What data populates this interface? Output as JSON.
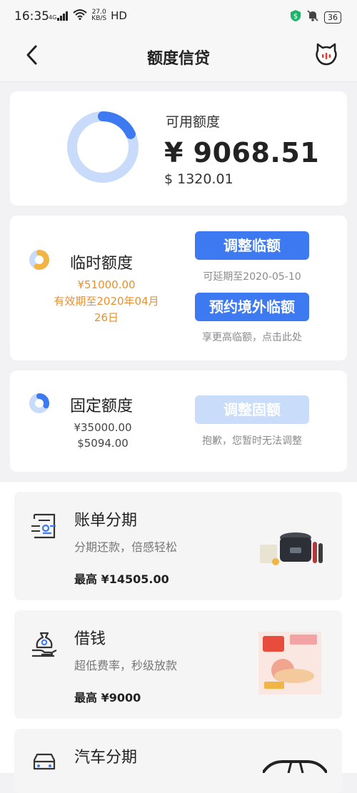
{
  "status": {
    "time": "16:35",
    "signal": "4G",
    "net_speed_value": "27.0",
    "net_speed_unit": "KB/S",
    "hd": "HD",
    "battery": "36"
  },
  "nav": {
    "title": "额度信贷",
    "back_icon": "chevron-left-icon",
    "service_icon": "customer-service-icon"
  },
  "balance": {
    "label": "可用额度",
    "cny": "¥ 9068.51",
    "usd": "$ 1320.01",
    "ring_fraction": 0.18,
    "colors": {
      "accent": "#3d7af2",
      "track": "#c8dbfa"
    }
  },
  "temp_limit": {
    "title": "临时额度",
    "amount": "¥51000.00",
    "validity_line1": "有效期至2020年04月",
    "validity_line2": "26日",
    "adjust_button": "调整临额",
    "extend_hint": "可延期至2020-05-10",
    "overseas_button": "预约境外临额",
    "overseas_hint": "享更高临额，点击此处",
    "ring_fraction": 0.55
  },
  "fixed_limit": {
    "title": "固定额度",
    "amount_cny": "¥35000.00",
    "amount_usd": "$5094.00",
    "adjust_button": "调整固额",
    "disabled_hint": "抱歉，您暂时无法调整",
    "ring_fraction": 0.3
  },
  "products": [
    {
      "title": "账单分期",
      "subtitle": "分期还款，倍感轻松",
      "max": "最高 ¥14505.00",
      "icon": "bill-installment-icon"
    },
    {
      "title": "借钱",
      "subtitle": "超低费率，秒级放款",
      "max": "最高 ¥9000",
      "icon": "money-bag-icon"
    },
    {
      "title": "汽车分期",
      "icon": "car-icon"
    }
  ]
}
